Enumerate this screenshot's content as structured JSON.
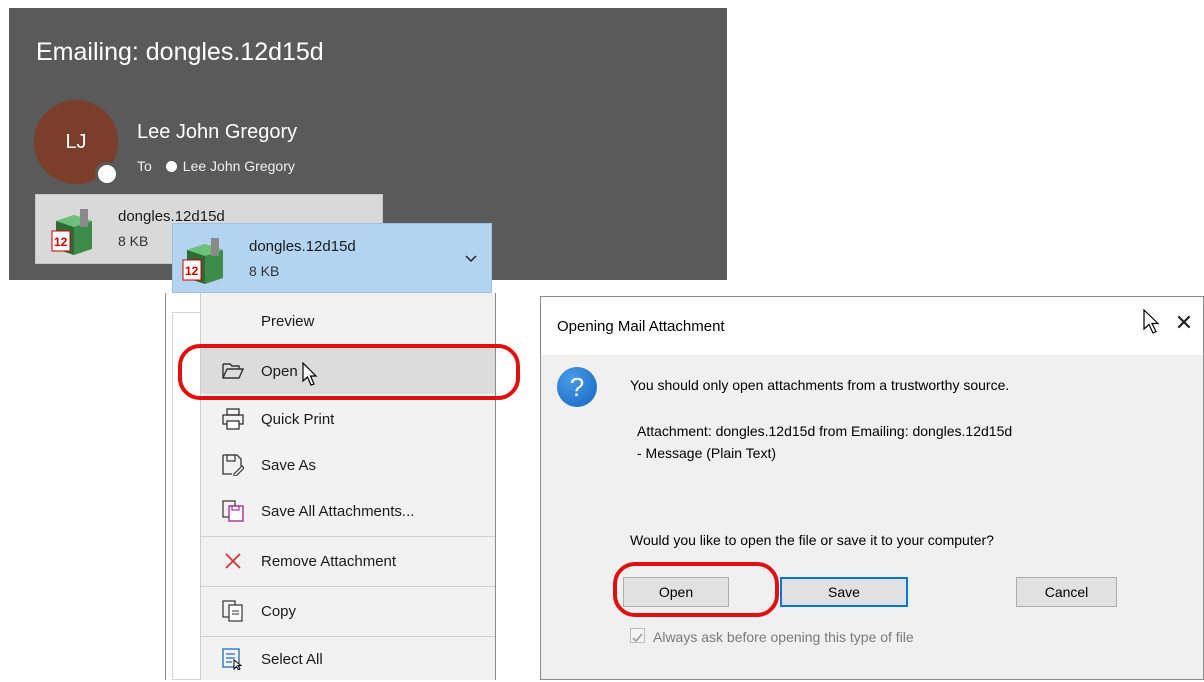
{
  "mail": {
    "title": "Emailing: dongles.12d15d",
    "sender": "Lee John Gregory",
    "avatar_initials": "LJ",
    "to_label": "To",
    "to_recipient": "Lee John Gregory"
  },
  "attachment": {
    "name": "dongles.12d15d",
    "size": "8 KB",
    "icon": "app-12-file-icon"
  },
  "context_menu": {
    "items": [
      {
        "label": "Preview",
        "accel": "P",
        "icon": "none"
      },
      {
        "label": "Open",
        "accel": "O",
        "icon": "open-folder-icon"
      },
      {
        "label": "Quick Print",
        "icon": "printer-icon"
      },
      {
        "label": "Save As",
        "accel": "S",
        "icon": "save-as-icon"
      },
      {
        "label": "Save All Attachments...",
        "icon": "save-all-icon"
      },
      {
        "label": "Remove Attachment",
        "icon": "remove-x-icon"
      },
      {
        "label": "Copy",
        "accel": "C",
        "icon": "copy-icon"
      },
      {
        "label": "Select All",
        "icon": "select-all-icon"
      }
    ]
  },
  "dialog": {
    "title": "Opening Mail Attachment",
    "message": "You should only open attachments from a trustworthy source.",
    "attachment_line1": "Attachment: dongles.12d15d from Emailing: dongles.12d15d",
    "attachment_line2": "- Message (Plain Text)",
    "question": "Would you like to open the file or save it to your computer?",
    "buttons": {
      "open": "Open",
      "save": "Save",
      "cancel": "Cancel"
    },
    "checkbox_label": "Always ask before opening this type of file",
    "checkbox_checked": true
  },
  "colors": {
    "header_bg": "#5a5a5a",
    "avatar_bg": "#7a3e2b",
    "selected_attachment_bg": "#b2d4f0",
    "highlight_ring": "#e01010",
    "default_button_border": "#0078d7"
  }
}
